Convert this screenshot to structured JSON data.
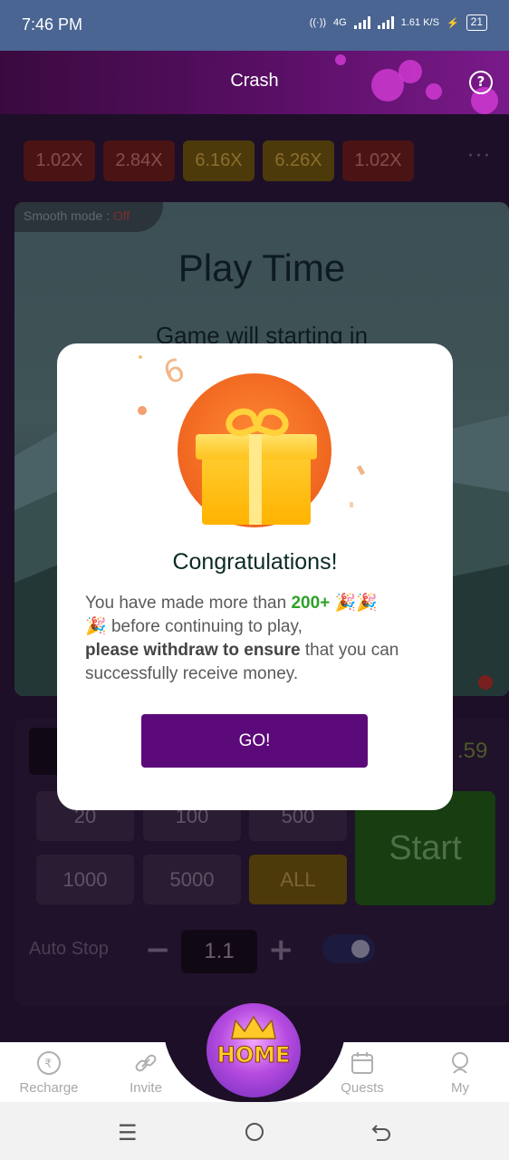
{
  "status_bar": {
    "time": "7:46 PM",
    "network": "4G",
    "speed": "1.61",
    "speed_unit": "K/S",
    "battery": "21"
  },
  "header": {
    "title": "Crash"
  },
  "game": {
    "multipliers": [
      {
        "label": "1.02X",
        "color": "#4a1414"
      },
      {
        "label": "2.84X",
        "color": "#4a1414"
      },
      {
        "label": "6.16X",
        "color": "#4d3a0b"
      },
      {
        "label": "6.26X",
        "color": "#4d3a0b"
      },
      {
        "label": "1.02X",
        "color": "#4a1414"
      }
    ],
    "more": "···",
    "smooth_mode_label": "Smooth mode :",
    "smooth_mode_value": "Off",
    "play_title": "Play Time",
    "play_subtitle": "Game will starting in",
    "balance_value": ".59",
    "chips": [
      "20",
      "100",
      "500",
      "1000",
      "5000",
      "ALL"
    ],
    "start_label": "Start",
    "auto_stop_label": "Auto Stop",
    "auto_stop_value": "1.1",
    "minus": "−",
    "plus": "+"
  },
  "modal": {
    "title": "Congratulations!",
    "body_prefix": "You have made more than",
    "body_highlight": "200+",
    "body_emoji1": "🎉🎉",
    "body_emoji2": "🎉",
    "body_mid": "before continuing to play,",
    "body_bold": "please withdraw to ensure",
    "body_suffix": "that you can successfully receive money.",
    "button_label": "GO!",
    "confetti_digit": "6"
  },
  "bottom_nav": {
    "items": [
      {
        "label": "Recharge",
        "icon": "recharge-icon"
      },
      {
        "label": "Invite",
        "icon": "link-icon"
      },
      {
        "label": "Quests",
        "icon": "calendar-icon"
      },
      {
        "label": "My",
        "icon": "profile-icon"
      }
    ],
    "home_label": "HOME"
  },
  "colors": {
    "accent": "#5c0a7a",
    "highlight": "#2ea12a",
    "gift": "#f26a22"
  }
}
